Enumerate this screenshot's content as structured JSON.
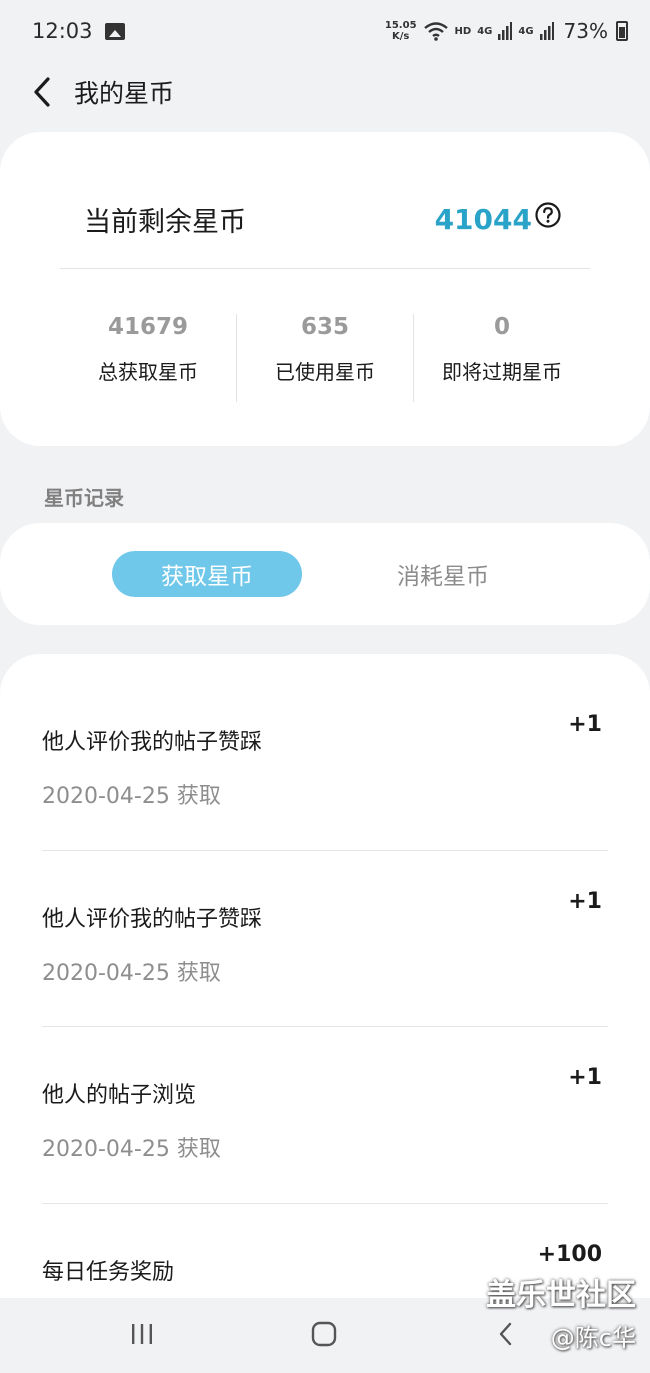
{
  "status_bar": {
    "time": "12:03",
    "net_speed_value": "15.05",
    "net_speed_unit": "K/s",
    "hd_label": "HD",
    "signal1_label": "4G",
    "signal2_label": "4G",
    "battery": "73%"
  },
  "app_bar": {
    "title": "我的星币"
  },
  "balance": {
    "label": "当前剩余星币",
    "value": "41044"
  },
  "stats": [
    {
      "value": "41679",
      "label": "总获取星币"
    },
    {
      "value": "635",
      "label": "已使用星币"
    },
    {
      "value": "0",
      "label": "即将过期星币"
    }
  ],
  "records_section": {
    "title": "星币记录"
  },
  "tabs": [
    {
      "label": "获取星币",
      "active": true
    },
    {
      "label": "消耗星币",
      "active": false
    }
  ],
  "records": [
    {
      "title": "他人评价我的帖子赞踩",
      "date": "2020-04-25 获取",
      "points": "+1"
    },
    {
      "title": "他人评价我的帖子赞踩",
      "date": "2020-04-25 获取",
      "points": "+1"
    },
    {
      "title": "他人的帖子浏览",
      "date": "2020-04-25 获取",
      "points": "+1"
    },
    {
      "title": "每日任务奖励",
      "date": "",
      "points": "+100"
    }
  ],
  "watermark": {
    "site": "盖乐世社区",
    "user": "@陈c华"
  },
  "colors": {
    "accent": "#2aa3c8",
    "tab_active_bg": "#6fc7e9",
    "background": "#f1f2f4"
  },
  "icons": {
    "back": "chevron-left-icon",
    "help": "question-circle-icon",
    "gallery": "image-icon",
    "wifi": "wifi-icon",
    "battery": "battery-icon"
  }
}
